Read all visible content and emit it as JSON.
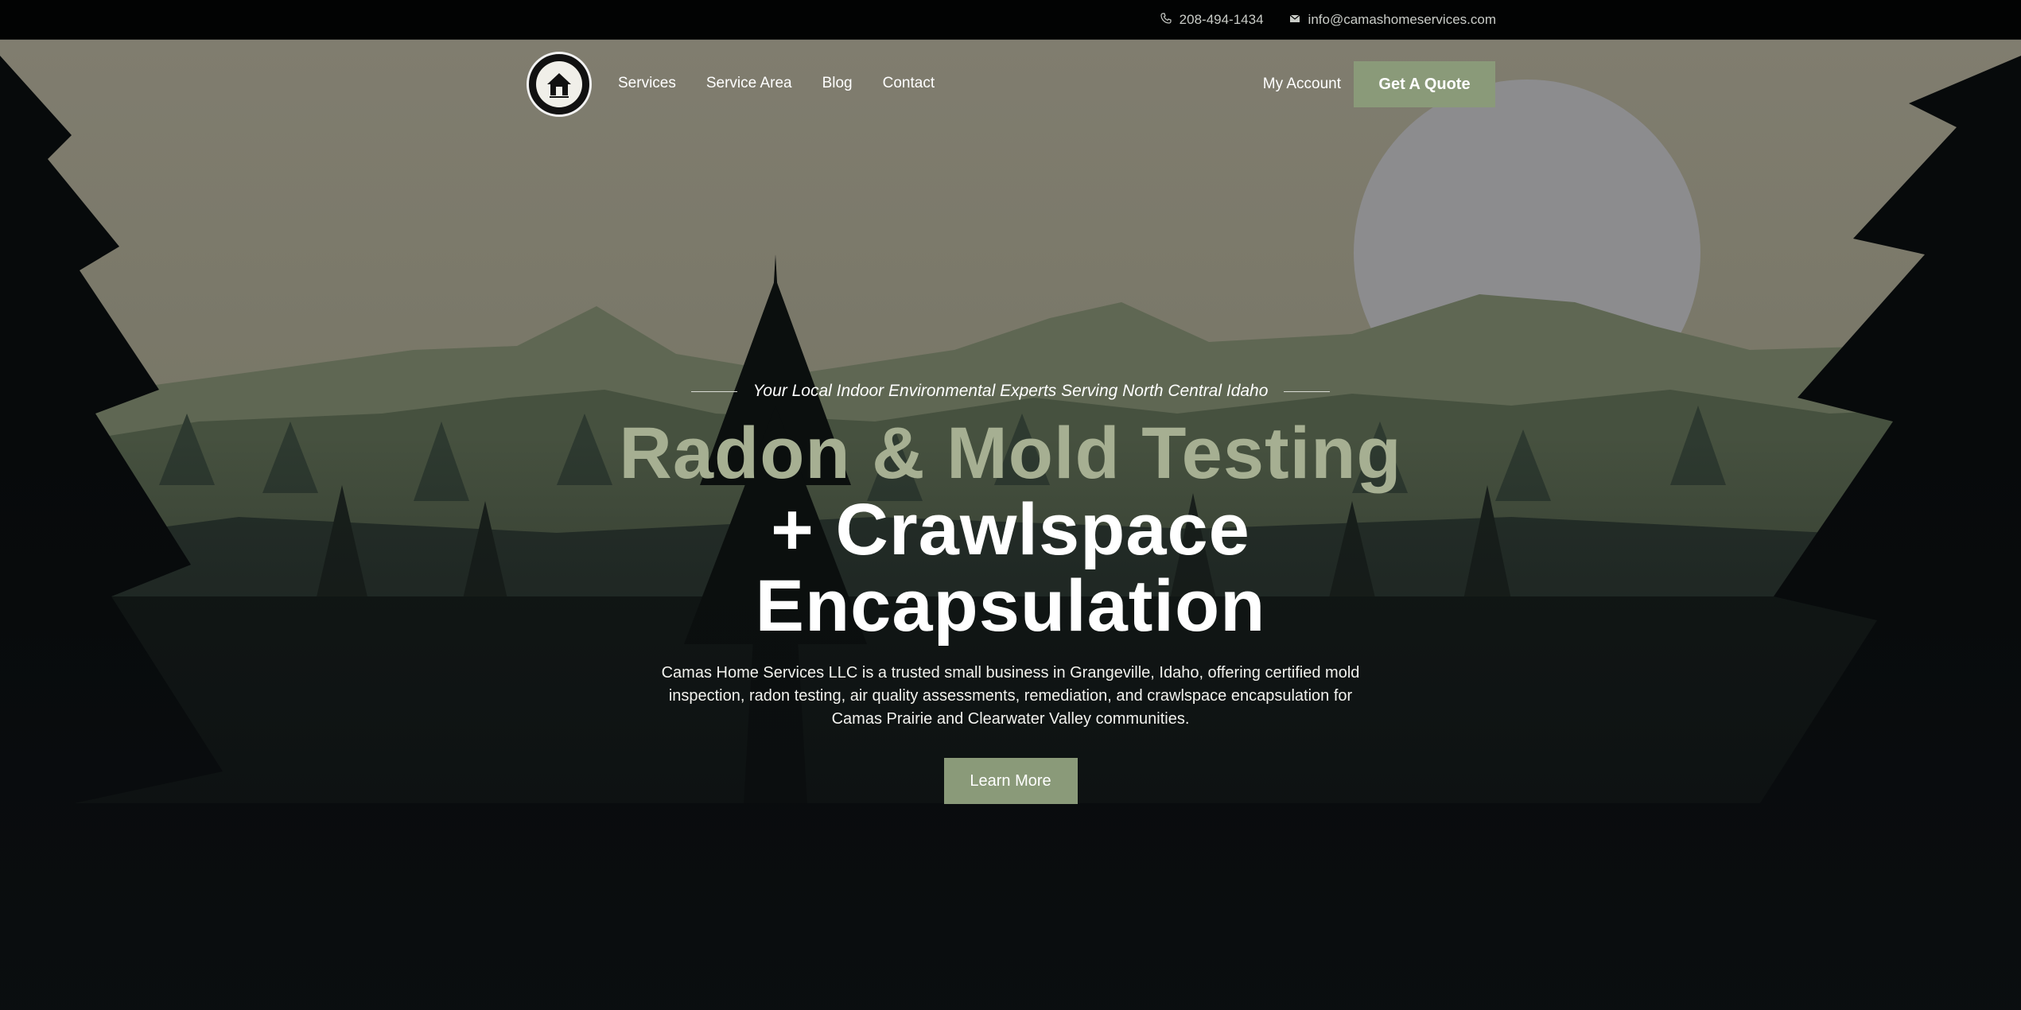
{
  "topbar": {
    "phone": "208-494-1434",
    "email": "info@camashomeservices.com",
    "phone_icon": "phone-icon",
    "email_icon": "envelope-icon"
  },
  "nav": {
    "logo_alt": "Camas Home Services LLC",
    "links": [
      "Services",
      "Service Area",
      "Blog",
      "Contact"
    ],
    "account": "My Account",
    "quote_button": "Get A Quote"
  },
  "hero": {
    "tagline": "Your Local Indoor Environmental Experts Serving North Central Idaho",
    "title_line1": "Radon & Mold Testing",
    "title_line2": "+ Crawlspace",
    "title_line3": "Encapsulation",
    "description": "Camas Home Services LLC is a trusted small business in Grangeville, Idaho, offering certified mold inspection, radon testing, air quality assessments, remediation, and crawlspace encapsulation for Camas Prairie and Clearwater Valley communities.",
    "button": "Learn More"
  },
  "colors": {
    "accent": "#8a9a79",
    "title_accent": "#a6af92",
    "sky": "#7c7b6d",
    "moon": "#8c8c8e",
    "topbar": "#020303"
  }
}
